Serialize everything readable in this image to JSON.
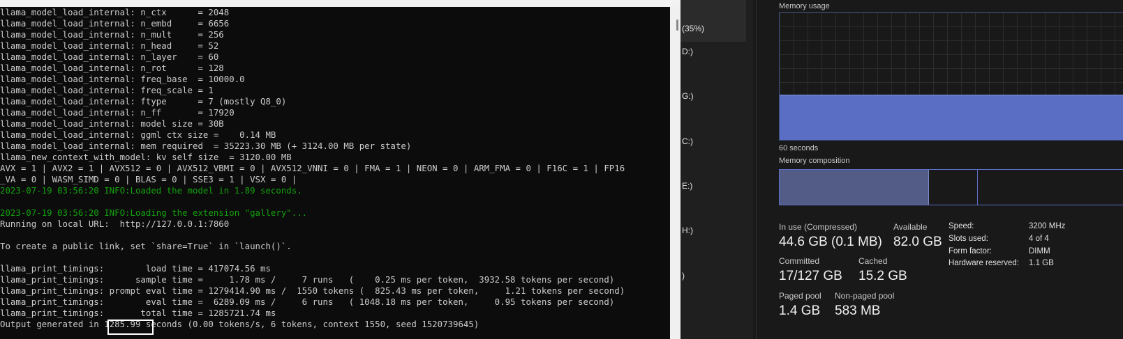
{
  "terminal": {
    "lines": [
      {
        "text": "llama_model_load_internal: n_ctx      = 2048",
        "color": "default"
      },
      {
        "text": "llama_model_load_internal: n_embd     = 6656",
        "color": "default"
      },
      {
        "text": "llama_model_load_internal: n_mult     = 256",
        "color": "default"
      },
      {
        "text": "llama_model_load_internal: n_head     = 52",
        "color": "default"
      },
      {
        "text": "llama_model_load_internal: n_layer    = 60",
        "color": "default"
      },
      {
        "text": "llama_model_load_internal: n_rot      = 128",
        "color": "default"
      },
      {
        "text": "llama_model_load_internal: freq_base  = 10000.0",
        "color": "default"
      },
      {
        "text": "llama_model_load_internal: freq_scale = 1",
        "color": "default"
      },
      {
        "text": "llama_model_load_internal: ftype      = 7 (mostly Q8_0)",
        "color": "default"
      },
      {
        "text": "llama_model_load_internal: n_ff       = 17920",
        "color": "default"
      },
      {
        "text": "llama_model_load_internal: model size = 30B",
        "color": "default"
      },
      {
        "text": "llama_model_load_internal: ggml ctx size =    0.14 MB",
        "color": "default"
      },
      {
        "text": "llama_model_load_internal: mem required  = 35223.30 MB (+ 3124.00 MB per state)",
        "color": "default"
      },
      {
        "text": "llama_new_context_with_model: kv self size  = 3120.00 MB",
        "color": "default"
      },
      {
        "text": "AVX = 1 | AVX2 = 1 | AVX512 = 0 | AVX512_VBMI = 0 | AVX512_VNNI = 0 | FMA = 1 | NEON = 0 | ARM_FMA = 0 | F16C = 1 | FP16",
        "color": "default"
      },
      {
        "text": "_VA = 0 | WASM_SIMD = 0 | BLAS = 0 | SSE3 = 1 | VSX = 0 |",
        "color": "default"
      },
      {
        "text": "2023-07-19 03:56:20 INFO:Loaded the model in 1.89 seconds.",
        "color": "green"
      },
      {
        "text": "",
        "color": "default"
      },
      {
        "text": "2023-07-19 03:56:20 INFO:Loading the extension \"gallery\"...",
        "color": "green"
      },
      {
        "text": "Running on local URL:  http://127.0.0.1:7860",
        "color": "default"
      },
      {
        "text": "",
        "color": "default"
      },
      {
        "text": "To create a public link, set `share=True` in `launch()`.",
        "color": "default"
      },
      {
        "text": "",
        "color": "default"
      },
      {
        "text": "llama_print_timings:        load time = 417074.56 ms",
        "color": "default"
      },
      {
        "text": "llama_print_timings:      sample time =     1.78 ms /     7 runs   (    0.25 ms per token,  3932.58 tokens per second)",
        "color": "default"
      },
      {
        "text": "llama_print_timings: prompt eval time = 1279414.90 ms /  1550 tokens (  825.43 ms per token,     1.21 tokens per second)",
        "color": "default"
      },
      {
        "text": "llama_print_timings:        eval time =  6289.09 ms /     6 runs   ( 1048.18 ms per token,     0.95 tokens per second)",
        "color": "default"
      },
      {
        "text": "llama_print_timings:       total time = 1285721.74 ms",
        "color": "default"
      },
      {
        "text": "Output generated in 1285.99 seconds (0.00 tokens/s, 6 tokens, context 1550, seed 1520739645)",
        "color": "default"
      }
    ]
  },
  "taskmanager": {
    "sidebar_fragments": [
      "(35%)",
      "D:)",
      "G:)",
      "C:)",
      "E:)",
      "H:)",
      ")"
    ],
    "memory_usage_label": "Memory usage",
    "time_label": "60 seconds",
    "memory_composition_label": "Memory composition",
    "graph_usage_fraction": 0.35,
    "stats": {
      "in_use_label": "In use (Compressed)",
      "in_use_value": "44.6 GB (0.1 MB)",
      "available_label": "Available",
      "available_value": "82.0 GB",
      "committed_label": "Committed",
      "committed_value": "17/127 GB",
      "cached_label": "Cached",
      "cached_value": "15.2 GB",
      "paged_pool_label": "Paged pool",
      "paged_pool_value": "1.4 GB",
      "non_paged_pool_label": "Non-paged pool",
      "non_paged_pool_value": "583 MB"
    },
    "specs": [
      {
        "label": "Speed:",
        "value": "3200 MHz"
      },
      {
        "label": "Slots used:",
        "value": "4 of 4"
      },
      {
        "label": "Form factor:",
        "value": "DIMM"
      },
      {
        "label": "Hardware reserved:",
        "value": "1.1 GB"
      }
    ]
  },
  "colors": {
    "terminal_bg": "#0c0c0c",
    "terminal_text": "#cccccc",
    "terminal_green": "#13a10e",
    "memory_accent": "#5a6fc4"
  }
}
